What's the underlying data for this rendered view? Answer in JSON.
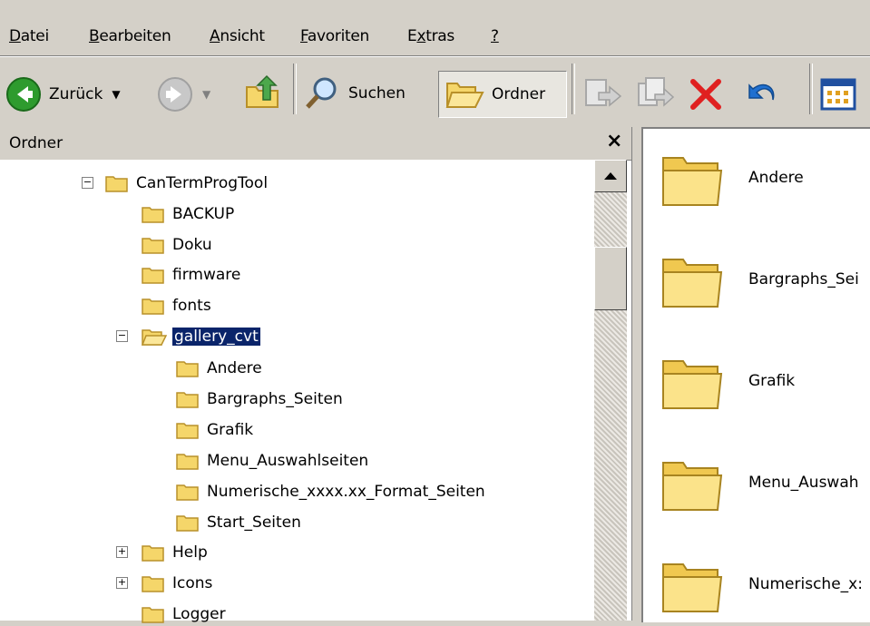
{
  "menubar": {
    "items": [
      {
        "pre": "",
        "acc": "D",
        "post": "atei"
      },
      {
        "pre": "",
        "acc": "B",
        "post": "earbeiten"
      },
      {
        "pre": "",
        "acc": "A",
        "post": "nsicht"
      },
      {
        "pre": "",
        "acc": "F",
        "post": "avoriten"
      },
      {
        "pre": "E",
        "acc": "x",
        "post": "tras"
      },
      {
        "pre": "",
        "acc": "?",
        "post": ""
      }
    ]
  },
  "toolbar": {
    "back_label": "Zurück",
    "search_label": "Suchen",
    "folders_label": "Ordner"
  },
  "folder_pane": {
    "title": "Ordner",
    "close_glyph": "×"
  },
  "tree": {
    "root": "CanTermProgTool",
    "children": [
      "BACKUP",
      "Doku",
      "firmware",
      "fonts"
    ],
    "selected": "gallery_cvt",
    "selected_children": [
      "Andere",
      "Bargraphs_Seiten",
      "Grafik",
      "Menu_Auswahlseiten",
      "Numerische_xxxx.xx_Format_Seiten",
      "Start_Seiten"
    ],
    "after": [
      "Help",
      "Icons",
      "Logger"
    ]
  },
  "content": {
    "items": [
      "Andere",
      "Bargraphs_Sei",
      "Grafik",
      "Menu_Auswah",
      "Numerische_x:"
    ]
  },
  "colors": {
    "selection": "#0a246a",
    "folder": "#f5d66a",
    "chrome": "#d4d0c8"
  }
}
